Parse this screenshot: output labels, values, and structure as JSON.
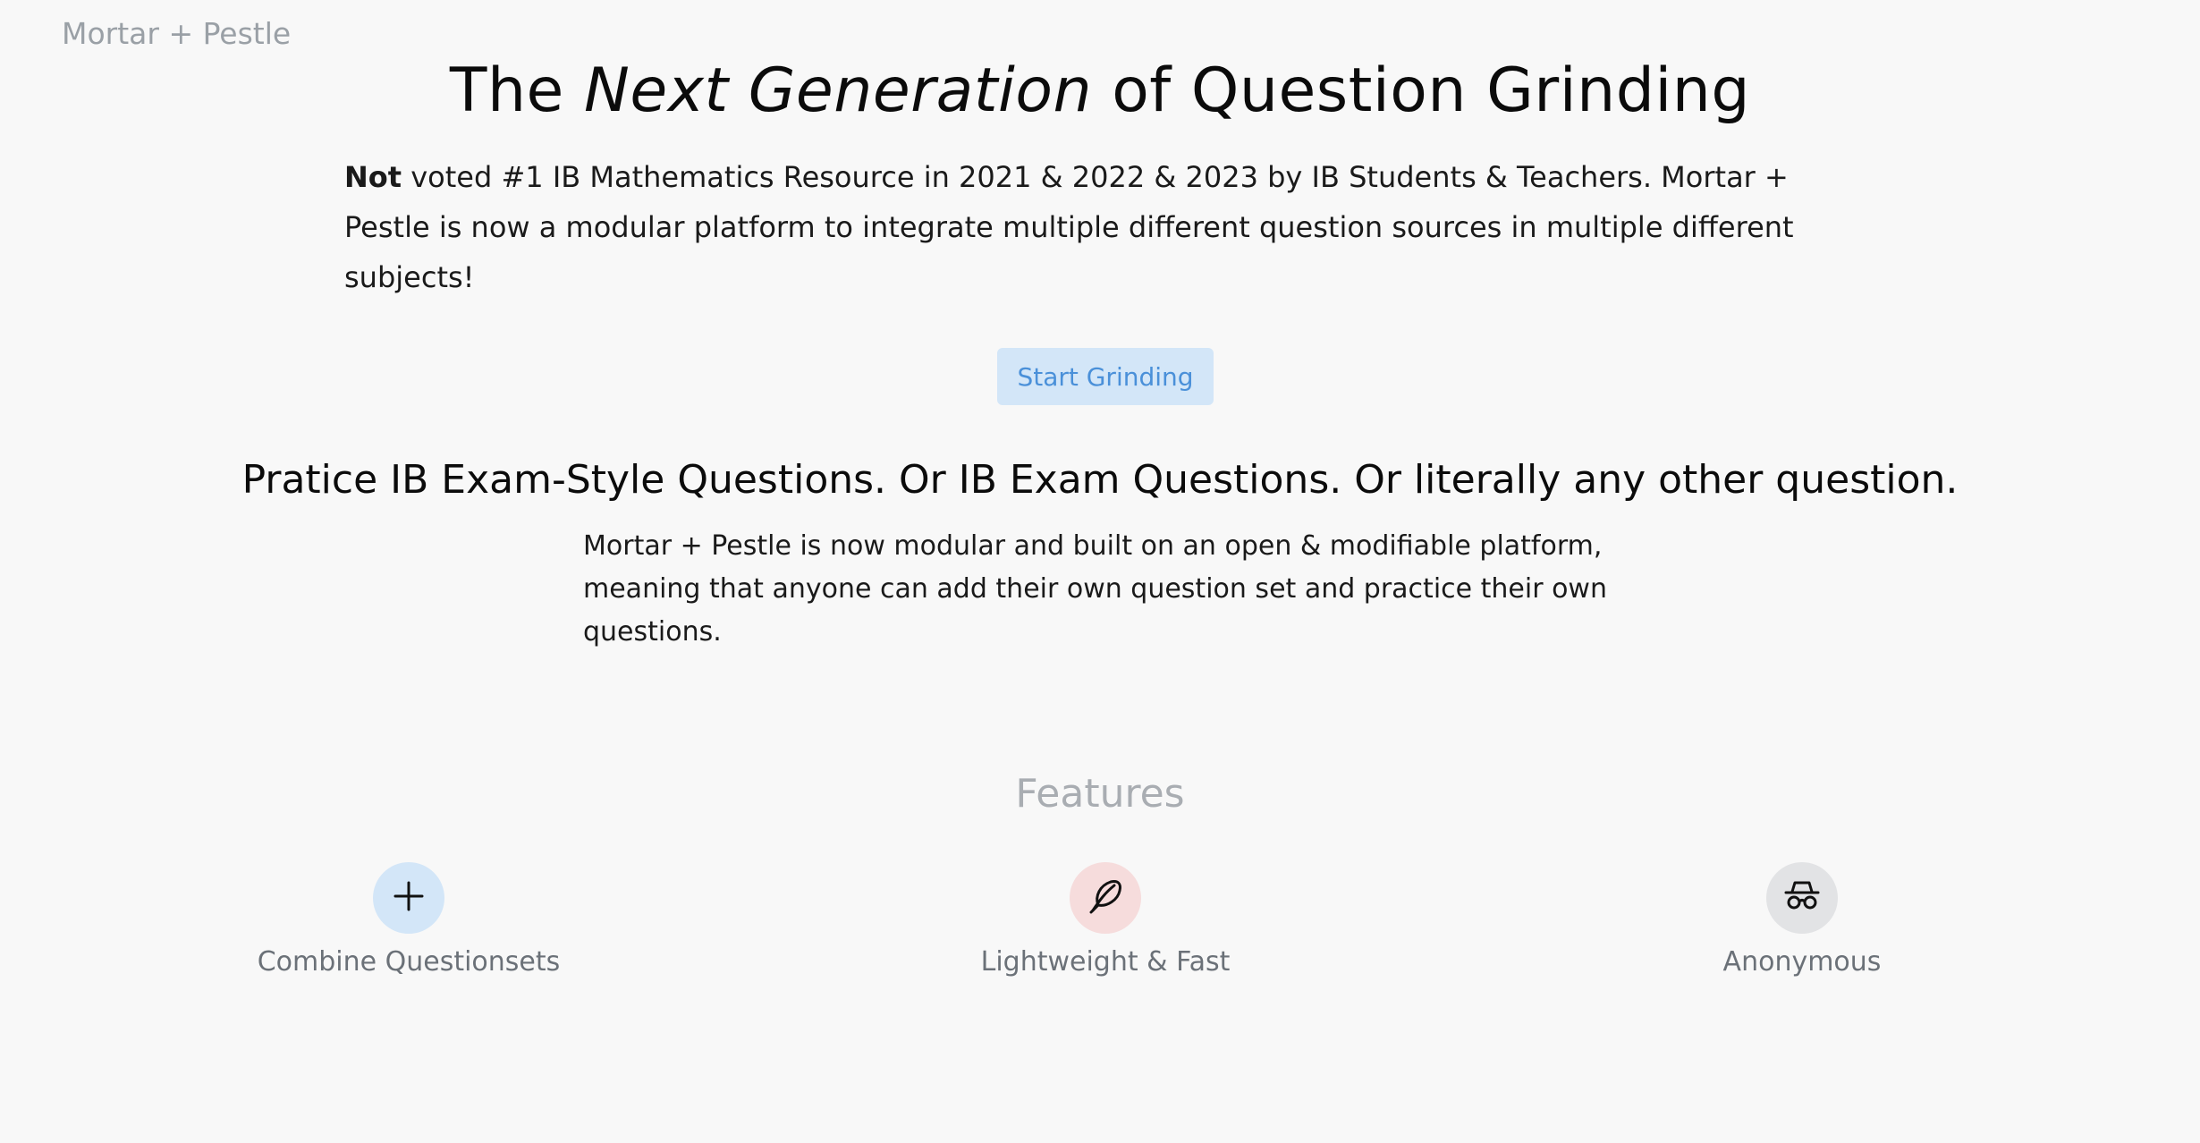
{
  "brand": {
    "name": "Mortar + Pestle"
  },
  "hero": {
    "title_pre": "The ",
    "title_em": "Next Generation",
    "title_post": " of Question Grinding",
    "text_bold": "Not",
    "text_rest": " voted #1 IB Mathematics Resource in 2021 & 2022 & 2023 by IB Students & Teachers. Mortar + Pestle is now a modular platform to integrate multiple different question sources in multiple different subjects!",
    "cta_label": "Start Grinding"
  },
  "section": {
    "heading": "Pratice IB Exam-Style Questions. Or IB Exam Questions. Or literally any other question.",
    "text": "Mortar + Pestle is now modular and built on an open & modifiable platform, meaning that anyone can add their own question set and practice their own questions."
  },
  "features": {
    "heading": "Features",
    "items": [
      {
        "label": "Combine Questionsets",
        "icon": "plus-icon",
        "bg": "#d3e6f8"
      },
      {
        "label": "Lightweight & Fast",
        "icon": "feather-icon",
        "bg": "#f6dcdc"
      },
      {
        "label": "Anonymous",
        "icon": "incognito-icon",
        "bg": "#e2e3e5"
      }
    ]
  },
  "colors": {
    "background": "#f8f8f8",
    "accent": "#4a90d9",
    "accent_bg": "#d3e6f8",
    "muted": "#9aa0a6"
  }
}
